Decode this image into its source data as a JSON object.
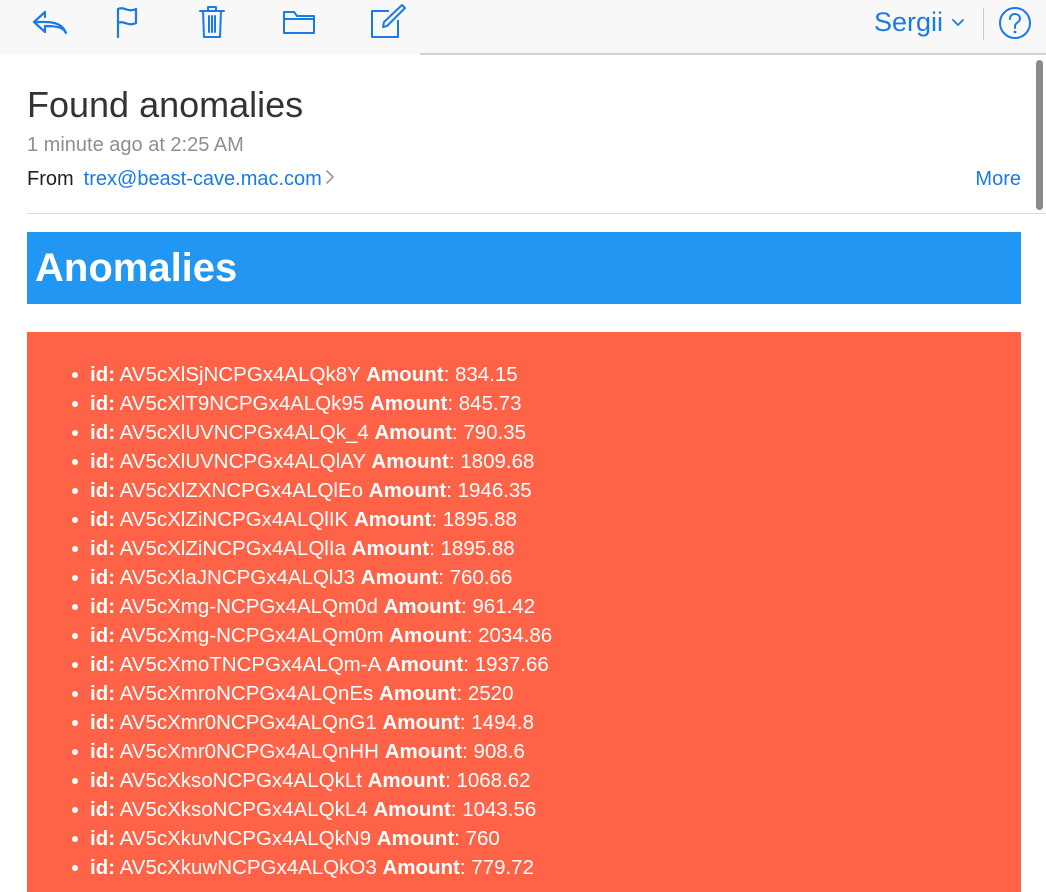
{
  "toolbar": {
    "buttons": [
      {
        "name": "reply-button",
        "icon": "reply-icon"
      },
      {
        "name": "flag-button",
        "icon": "flag-icon"
      },
      {
        "name": "trash-button",
        "icon": "trash-icon"
      },
      {
        "name": "move-to-folder-button",
        "icon": "folder-icon"
      },
      {
        "name": "compose-button",
        "icon": "compose-icon"
      }
    ],
    "account_name": "Sergii",
    "help_icon": "help-icon",
    "accent_color": "#1a7ae8"
  },
  "message": {
    "subject": "Found anomalies",
    "timestamp": "1 minute ago at 2:25 AM",
    "from_label": "From",
    "from_address": "trex@beast-cave.mac.com",
    "more_label": "More"
  },
  "body": {
    "banner_title": "Anomalies",
    "banner_color": "#2196f3",
    "panel_color": "#ff6347",
    "id_label": "id:",
    "amount_label": "Amount",
    "anomalies": [
      {
        "id": "AV5cXlSjNCPGx4ALQk8Y",
        "amount": "834.15"
      },
      {
        "id": "AV5cXlT9NCPGx4ALQk95",
        "amount": "845.73"
      },
      {
        "id": "AV5cXlUVNCPGx4ALQk_4",
        "amount": "790.35"
      },
      {
        "id": "AV5cXlUVNCPGx4ALQlAY",
        "amount": "1809.68"
      },
      {
        "id": "AV5cXlZXNCPGx4ALQlEo",
        "amount": "1946.35"
      },
      {
        "id": "AV5cXlZiNCPGx4ALQlIK",
        "amount": "1895.88"
      },
      {
        "id": "AV5cXlZiNCPGx4ALQlIa",
        "amount": "1895.88"
      },
      {
        "id": "AV5cXlaJNCPGx4ALQlJ3",
        "amount": "760.66"
      },
      {
        "id": "AV5cXmg-NCPGx4ALQm0d",
        "amount": "961.42"
      },
      {
        "id": "AV5cXmg-NCPGx4ALQm0m",
        "amount": "2034.86"
      },
      {
        "id": "AV5cXmoTNCPGx4ALQm-A",
        "amount": "1937.66"
      },
      {
        "id": "AV5cXmroNCPGx4ALQnEs",
        "amount": "2520"
      },
      {
        "id": "AV5cXmr0NCPGx4ALQnG1",
        "amount": "1494.8"
      },
      {
        "id": "AV5cXmr0NCPGx4ALQnHH",
        "amount": "908.6"
      },
      {
        "id": "AV5cXksoNCPGx4ALQkLt",
        "amount": "1068.62"
      },
      {
        "id": "AV5cXksoNCPGx4ALQkL4",
        "amount": "1043.56"
      },
      {
        "id": "AV5cXkuvNCPGx4ALQkN9",
        "amount": "760"
      },
      {
        "id": "AV5cXkuwNCPGx4ALQkO3",
        "amount": "779.72"
      }
    ]
  }
}
